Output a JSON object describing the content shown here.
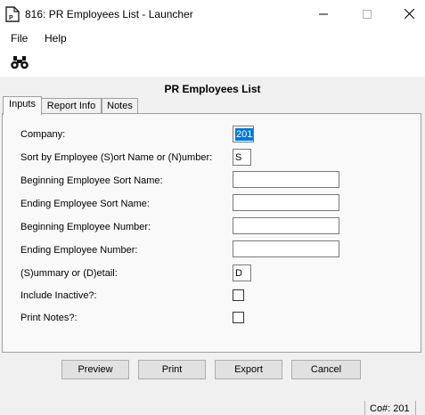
{
  "window": {
    "title": "816: PR Employees List - Launcher",
    "app_icon": "pr-document-icon",
    "controls": [
      "minimize-icon",
      "maximize-icon",
      "close-icon"
    ]
  },
  "menu": {
    "items": [
      {
        "label": "File"
      },
      {
        "label": "Help"
      }
    ]
  },
  "toolbar": {
    "find_icon": "binoculars-icon"
  },
  "form": {
    "title": "PR Employees List",
    "tabs": [
      {
        "label": "Inputs",
        "active": true
      },
      {
        "label": "Report Info",
        "active": false
      },
      {
        "label": "Notes",
        "active": false
      }
    ],
    "fields": {
      "company": {
        "label": "Company:",
        "value": "201"
      },
      "sort_by": {
        "label": "Sort by Employee (S)ort Name or (N)umber:",
        "value": "S"
      },
      "begin_sort_name": {
        "label": "Beginning Employee Sort Name:",
        "value": ""
      },
      "end_sort_name": {
        "label": "Ending Employee Sort Name:",
        "value": ""
      },
      "begin_number": {
        "label": "Beginning Employee Number:",
        "value": ""
      },
      "end_number": {
        "label": "Ending Employee Number:",
        "value": ""
      },
      "summary_detail": {
        "label": "(S)ummary or (D)etail:",
        "value": "D"
      },
      "include_inactive": {
        "label": "Include Inactive?:",
        "checked": false
      },
      "print_notes": {
        "label": "Print Notes?:",
        "checked": false
      }
    }
  },
  "buttons": {
    "preview": "Preview",
    "print": "Print",
    "export": "Export",
    "cancel": "Cancel"
  },
  "status": {
    "company": "Co#: 201"
  }
}
